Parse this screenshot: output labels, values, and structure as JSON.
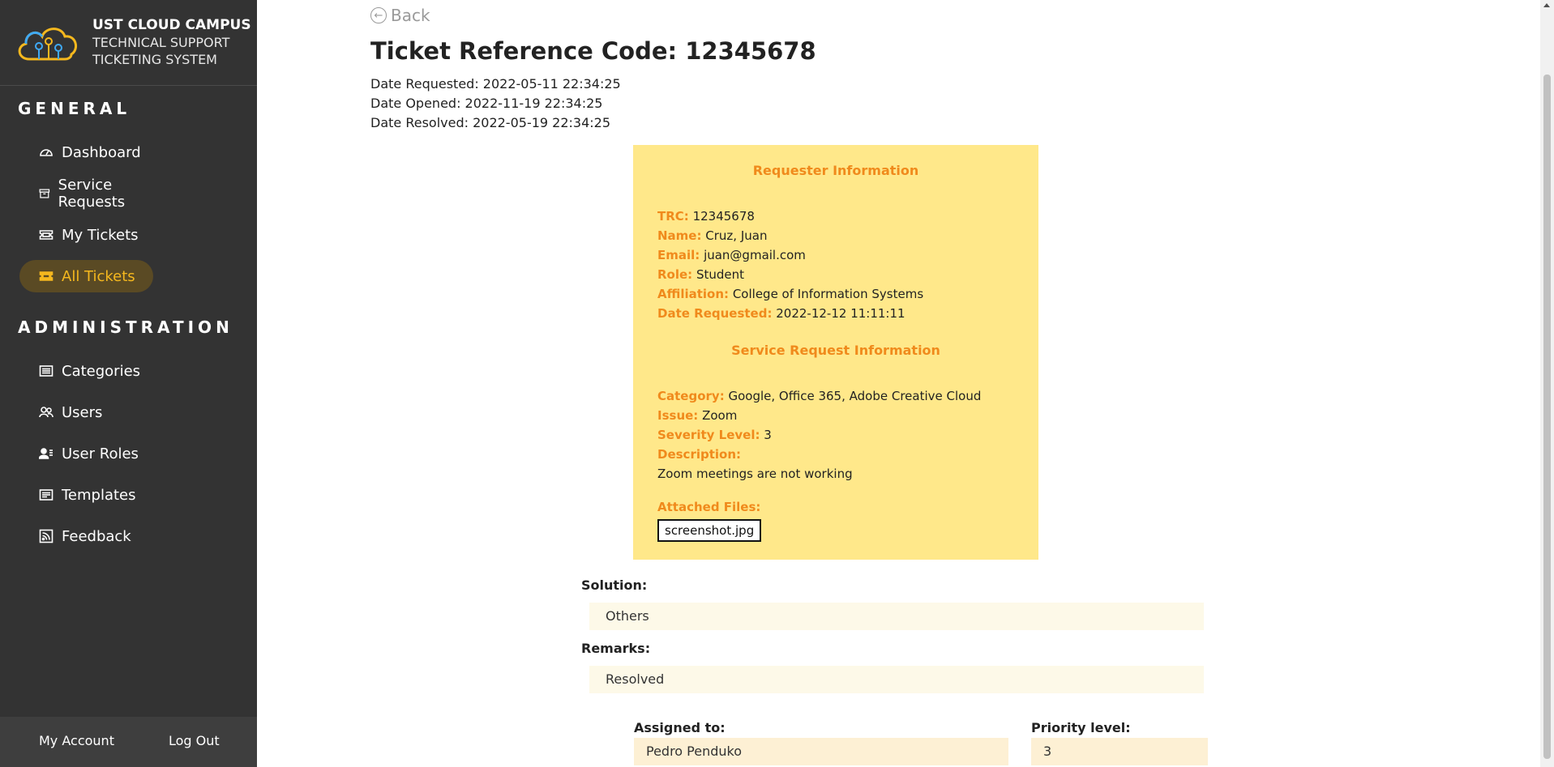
{
  "brand": {
    "title": "UST CLOUD CAMPUS",
    "subtitle_line1": "TECHNICAL SUPPORT",
    "subtitle_line2": "TICKETING SYSTEM"
  },
  "sidebar": {
    "general_title": "GENERAL",
    "general_items": [
      {
        "label": "Dashboard",
        "icon": "dashboard-icon"
      },
      {
        "label": "Service Requests",
        "icon": "archive-icon"
      },
      {
        "label": "My Tickets",
        "icon": "ticket-icon"
      },
      {
        "label": "All Tickets",
        "icon": "tickets-filled-icon",
        "active": true
      }
    ],
    "admin_title": "ADMINISTRATION",
    "admin_items": [
      {
        "label": "Categories",
        "icon": "list-icon"
      },
      {
        "label": "Users",
        "icon": "users-icon"
      },
      {
        "label": "User Roles",
        "icon": "user-roles-icon"
      },
      {
        "label": "Templates",
        "icon": "template-icon"
      },
      {
        "label": "Feedback",
        "icon": "rss-icon"
      }
    ],
    "footer": {
      "my_account": "My Account",
      "log_out": "Log Out"
    }
  },
  "main": {
    "back_label": "Back",
    "title": "Ticket Reference Code: 12345678",
    "dates": {
      "requested": "Date Requested: 2022-05-11 22:34:25",
      "opened": "Date Opened: 2022-11-19 22:34:25",
      "resolved": "Date Resolved: 2022-05-19 22:34:25"
    },
    "requester": {
      "heading": "Requester Information",
      "trc_label": "TRC:",
      "trc": "12345678",
      "name_label": "Name:",
      "name": "Cruz, Juan",
      "email_label": "Email:",
      "email": "juan@gmail.com",
      "role_label": "Role:",
      "role": "Student",
      "affiliation_label": "Affiliation:",
      "affiliation": "College of Information Systems",
      "date_label": "Date Requested:",
      "date": "2022-12-12 11:11:11"
    },
    "service": {
      "heading": "Service Request Information",
      "category_label": "Category:",
      "category": "Google, Office 365, Adobe Creative Cloud",
      "issue_label": "Issue:",
      "issue": "Zoom",
      "severity_label": "Severity Level:",
      "severity": "3",
      "description_label": "Description:",
      "description": "Zoom meetings are not working",
      "attached_label": "Attached Files:",
      "file": "screenshot.jpg"
    },
    "solution_label": "Solution:",
    "solution": "Others",
    "remarks_label": "Remarks:",
    "remarks": "Resolved",
    "assigned_label": "Assigned to:",
    "assigned": "Pedro Penduko",
    "priority_label": "Priority level:",
    "priority": "3"
  },
  "colors": {
    "sidebar_bg": "#333333",
    "accent": "#f5b81e",
    "card_bg": "#ffe88a",
    "card_label": "#f08a1c"
  }
}
